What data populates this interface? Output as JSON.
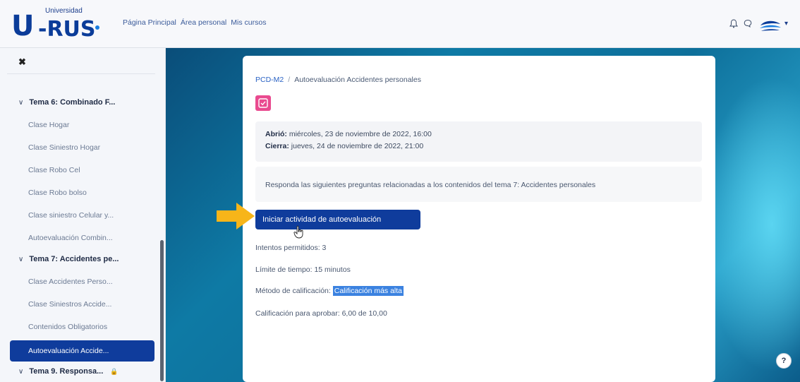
{
  "brand": {
    "small_text": "Universidad",
    "u_letter": "U",
    "rus_text": "-RUS"
  },
  "nav": {
    "items": [
      "Página Principal",
      "Área personal",
      "Mis cursos"
    ]
  },
  "sidebar": {
    "close_icon": "close-icon",
    "items": [
      {
        "type": "section",
        "label": "Tema 6: Combinado F..."
      },
      {
        "type": "item",
        "label": "Clase Hogar"
      },
      {
        "type": "item",
        "label": "Clase Siniestro Hogar"
      },
      {
        "type": "item",
        "label": "Clase Robo Cel"
      },
      {
        "type": "item",
        "label": "Clase Robo bolso"
      },
      {
        "type": "item",
        "label": "Clase siniestro Celular y..."
      },
      {
        "type": "item",
        "label": "Autoevaluación Combin..."
      },
      {
        "type": "section",
        "label": "Tema 7: Accidentes pe..."
      },
      {
        "type": "item",
        "label": "Clase Accidentes Perso..."
      },
      {
        "type": "item",
        "label": "Clase Siniestros Accide..."
      },
      {
        "type": "item",
        "label": "Contenidos Obligatorios"
      },
      {
        "type": "item",
        "label": "Autoevaluación Accide...",
        "active": true
      },
      {
        "type": "section",
        "label": "Tema 9. Responsa...",
        "locked": true
      }
    ]
  },
  "main": {
    "breadcrumb": {
      "course": "PCD-M2",
      "separator": "/",
      "current": "Autoevaluación Accidentes personales"
    },
    "dates": {
      "opened_label": "Abrió:",
      "opened_value": "miércoles, 23 de noviembre de 2022, 16:00",
      "closes_label": "Cierra:",
      "closes_value": "jueves, 24 de noviembre de 2022, 21:00"
    },
    "description": "Responda las siguientes preguntas relacionadas a los contenidos del tema 7: Accidentes personales",
    "start_button": "Iniciar actividad de autoevaluación",
    "attempts": "Intentos permitidos: 3",
    "time_limit": "Límite de tiempo: 15 minutos",
    "grading_label": "Método de calificación:",
    "grading_value": "Calificación más alta",
    "pass_grade": "Calificación para aprobar: 6,00 de 10,00"
  },
  "help_button": "?",
  "colors": {
    "primary": "#0f3c9c",
    "quiz_icon": "#e94a8f",
    "highlight": "#3b82e0",
    "arrow": "#f7b519"
  }
}
